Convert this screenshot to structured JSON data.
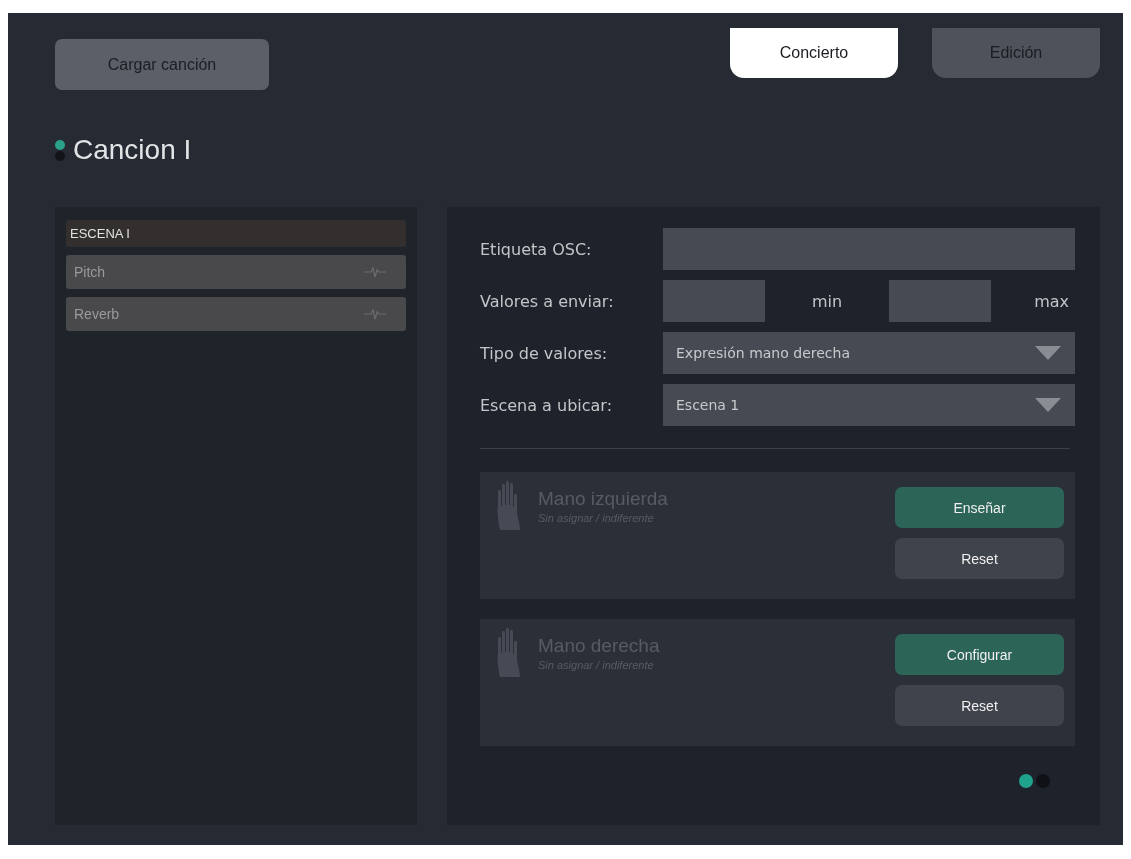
{
  "load_button": "Cargar canción",
  "tabs": [
    {
      "label": "Concierto",
      "selected": true
    },
    {
      "label": "Edición",
      "selected": false
    }
  ],
  "song": {
    "title": "Cancion I",
    "status_dots": [
      {
        "selected": true
      },
      {
        "selected": false
      }
    ]
  },
  "scene_list": {
    "header": "ESCENA I",
    "items": [
      {
        "label": "Pitch"
      },
      {
        "label": "Reverb"
      }
    ]
  },
  "form": [
    {
      "kind": "text",
      "label": "Etiqueta OSC:"
    },
    {
      "kind": "range",
      "label": "Valores a enviar:",
      "min_label": "min",
      "max_label": "max"
    },
    {
      "kind": "select",
      "label": "Tipo de valores:",
      "value": "Expresión mano derecha"
    },
    {
      "kind": "select",
      "label": "Escena a ubicar:",
      "value": "Escena 1"
    }
  ],
  "hands": [
    {
      "title": "Mano izquierda",
      "subtitle": "Sin asignar / indiferente",
      "primary": "Enseñar",
      "secondary": "Reset"
    },
    {
      "title": "Mano derecha",
      "subtitle": "Sin asignar / indiferente",
      "primary": "Configurar",
      "secondary": "Reset"
    }
  ],
  "pages": [
    {
      "selected": true
    },
    {
      "selected": false
    }
  ]
}
